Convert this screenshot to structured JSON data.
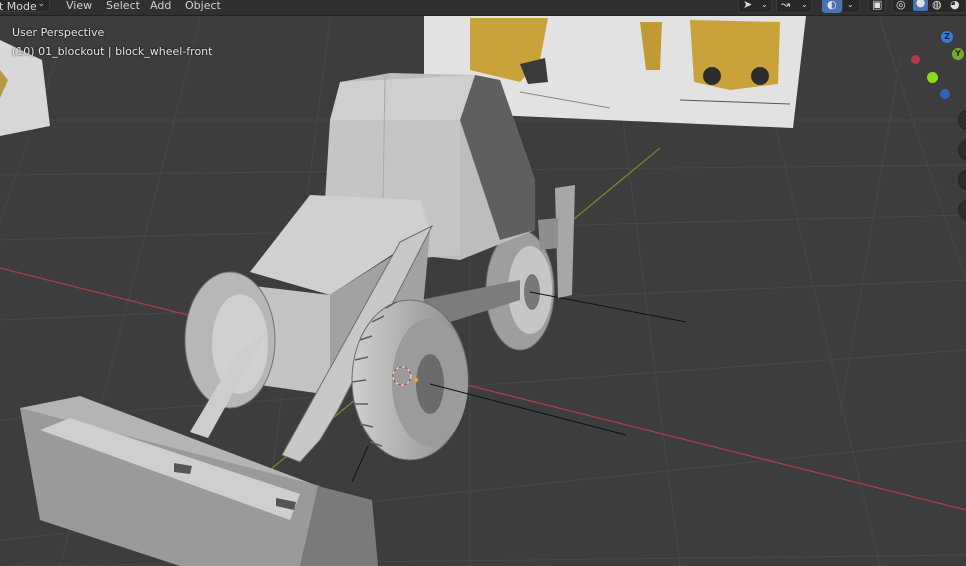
{
  "header": {
    "mode_label": "t Mode",
    "menus": [
      "View",
      "Select",
      "Add",
      "Object"
    ]
  },
  "viewport": {
    "perspective_label": "User Perspective",
    "object_label": "(10) 01_blockout | block_wheel-front"
  },
  "gizmo": {
    "z_label": "Z",
    "y_label": "Y"
  },
  "colors": {
    "axis_x": "#a83c4a",
    "axis_y": "#6a8a2b",
    "accent": "#4772b3",
    "background": "#3d3d3d"
  },
  "icons": [
    "chevron-down-icon",
    "pointer-icon",
    "transform-icon",
    "overlay-icon",
    "xray-icon",
    "wireframe-icon",
    "solid-shading-icon",
    "material-shading-icon",
    "render-shading-icon"
  ]
}
